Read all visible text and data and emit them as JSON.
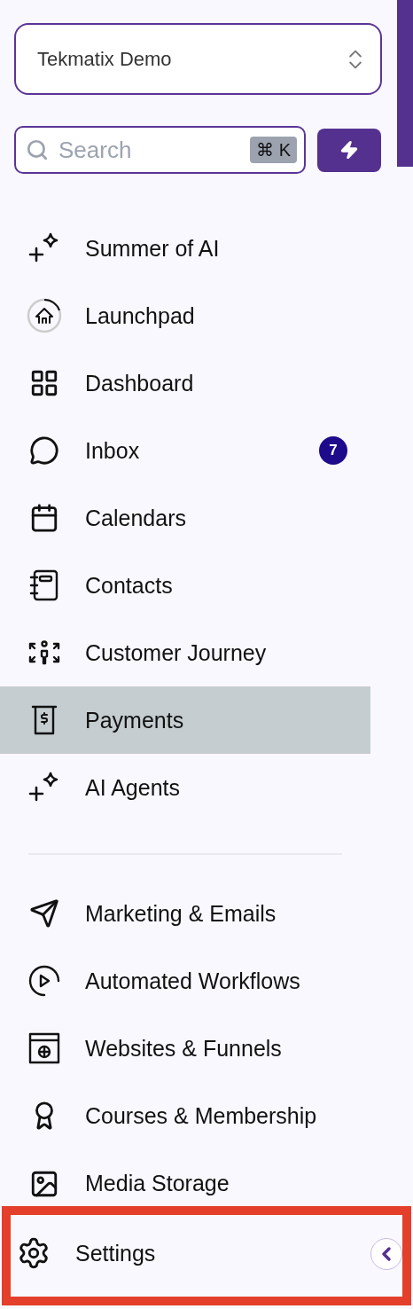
{
  "workspace": {
    "name": "Tekmatix Demo"
  },
  "search": {
    "placeholder": "Search",
    "shortcut": "⌘ K"
  },
  "nav_items": [
    {
      "label": "Summer of AI",
      "selected": false
    },
    {
      "label": "Launchpad",
      "selected": false
    },
    {
      "label": "Dashboard",
      "selected": false
    },
    {
      "label": "Inbox",
      "selected": false,
      "badge": "7"
    },
    {
      "label": "Calendars",
      "selected": false
    },
    {
      "label": "Contacts",
      "selected": false
    },
    {
      "label": "Customer Journey",
      "selected": false
    },
    {
      "label": "Payments",
      "selected": true
    },
    {
      "label": "AI Agents",
      "selected": false
    }
  ],
  "tool_items": [
    {
      "label": "Marketing & Emails",
      "selected": false
    },
    {
      "label": "Automated Workflows",
      "selected": false
    },
    {
      "label": "Websites & Funnels",
      "selected": false
    },
    {
      "label": "Courses & Membership",
      "selected": false
    },
    {
      "label": "Media Storage",
      "selected": false
    }
  ],
  "settings": {
    "label": "Settings",
    "highlighted": true
  }
}
